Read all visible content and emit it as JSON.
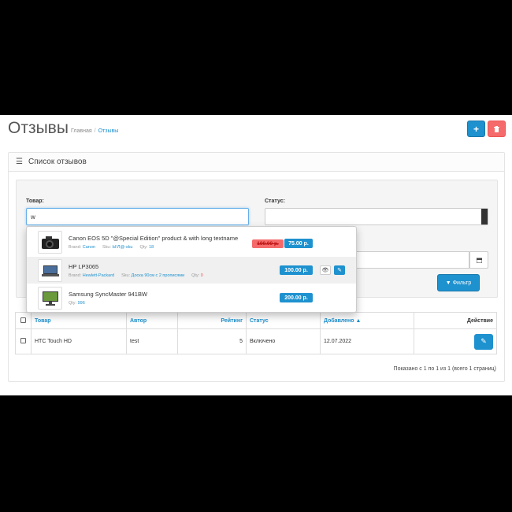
{
  "header": {
    "title": "Отзывы",
    "breadcrumb": {
      "home": "Главная",
      "separator": "/",
      "current": "Отзывы"
    }
  },
  "panel": {
    "title": "Список отзывов"
  },
  "filter": {
    "product_label": "Товар:",
    "product_value": "w",
    "status_label": "Статус:",
    "status_value": "",
    "date_value": "",
    "filter_button": "Фильтр"
  },
  "autocomplete": [
    {
      "name": "Canon EOS 5D \"@Special Edition\" product & with long textname",
      "brand_label": "Brand:",
      "brand": "Canon",
      "sku_label": "Sku:",
      "sku": "Ы!Л@-sku",
      "qty_label": "Qty:",
      "qty": "18",
      "old_price": "100.00 р.",
      "price": "75.00 р."
    },
    {
      "name": "HP LP3065",
      "brand_label": "Brand:",
      "brand": "Hewlett-Packard",
      "sku_label": "Sku:",
      "sku": "Доска 90см с 2 прописями",
      "qty_label": "Qty:",
      "qty": "0",
      "price": "100.00 р."
    },
    {
      "name": "Samsung SyncMaster 941BW",
      "qty_label": "Qty:",
      "qty": "996",
      "price": "200.00 р."
    }
  ],
  "table": {
    "headers": {
      "product": "Товар",
      "author": "Автор",
      "rating": "Рейтинг",
      "status": "Статус",
      "date_added": "Добавлено",
      "action": "Действие"
    },
    "rows": [
      {
        "product": "HTC Touch HD",
        "author": "test",
        "rating": "5",
        "status": "Включено",
        "date_added": "12.07.2022"
      }
    ]
  },
  "pagination": {
    "info": "Показано с 1 по 1 из 1 (всего 1 страниц)"
  },
  "colors": {
    "primary": "#1e91cf",
    "danger": "#f56b6b"
  }
}
